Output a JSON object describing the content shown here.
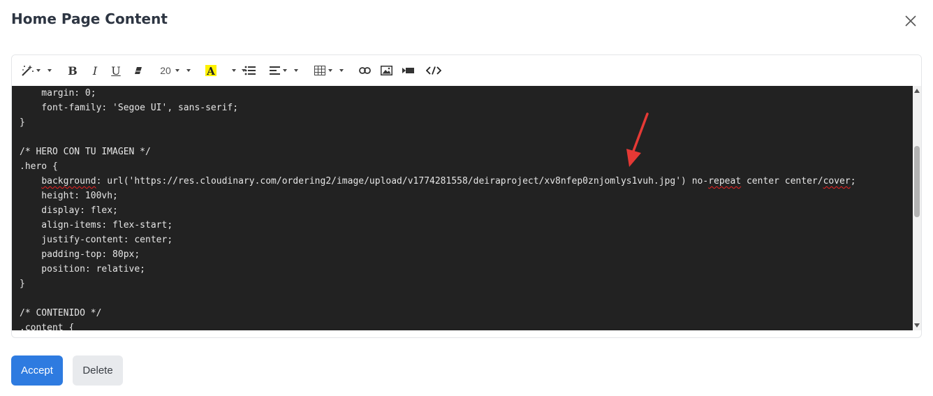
{
  "modal": {
    "title": "Home Page Content"
  },
  "toolbar": {
    "bold_label": "B",
    "italic_label": "I",
    "underline_label": "U",
    "font_size": "20"
  },
  "code": {
    "lines": [
      "    margin: 0;",
      "    font-family: 'Segoe UI', sans-serif;",
      "}",
      "",
      "/* HERO CON TU IMAGEN */",
      ".hero {",
      "    background: url('https://res.cloudinary.com/ordering2/image/upload/v1774281558/deiraproject/xv8nfep0znjomlys1vuh.jpg') no-repeat center center/cover;",
      "    height: 100vh;",
      "    display: flex;",
      "    align-items: flex-start;",
      "    justify-content: center;",
      "    padding-top: 80px;",
      "    position: relative;",
      "}",
      "",
      "/* CONTENIDO */",
      ".content {"
    ]
  },
  "actions": {
    "accept_label": "Accept",
    "delete_label": "Delete"
  },
  "colors": {
    "accent": "#2e7be0",
    "annotation_arrow": "#e53935",
    "code_background": "#222222"
  }
}
